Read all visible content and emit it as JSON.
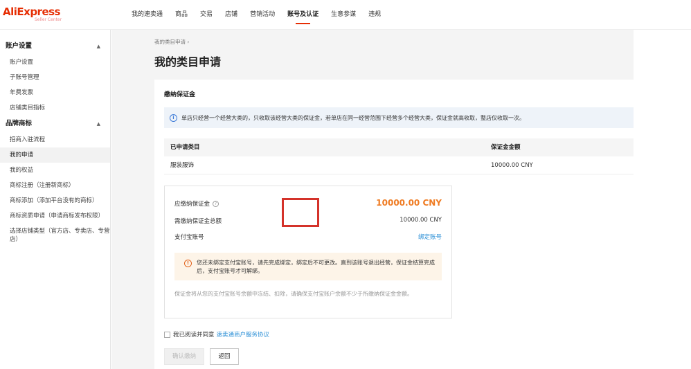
{
  "brand": {
    "name": "AliExpress",
    "sub": "Seller Center",
    "color": "#e62e04"
  },
  "nav": {
    "items": [
      "我的速卖通",
      "商品",
      "交易",
      "店铺",
      "营销活动",
      "账号及认证",
      "生意参谋",
      "违规"
    ],
    "active_index": 5
  },
  "sidebar": {
    "groups": [
      {
        "title": "账户设置",
        "items": [
          "账户设置",
          "子账号管理",
          "年费发票",
          "店铺类目指标"
        ]
      },
      {
        "title": "品牌商标",
        "items": [
          "招商入驻流程",
          "我的申请",
          "我的权益",
          "商标注册（注册新商标）",
          "商标添加（添加平台没有的商标）",
          "商标资质申请（申请商标发布权限）",
          "选择店铺类型（官方店、专卖店、专营店）"
        ]
      }
    ],
    "active_item": "我的申请"
  },
  "breadcrumb": "我的类目申请 ›",
  "page_title": "我的类目申请",
  "section_title": "缴纳保证金",
  "info_text": "单店只经营一个经营大类的，只收取该经营大类的保证金，若单店在同一经营范围下经营多个经营大类，保证金就高收取，整店仅收取一次。",
  "table": {
    "headers": [
      "已申请类目",
      "保证金金额"
    ],
    "rows": [
      [
        "服装服饰",
        "10000.00  CNY"
      ]
    ]
  },
  "deposit": {
    "due_label": "应缴纳保证金",
    "due_amount": "10000.00 CNY",
    "total_label": "需缴纳保证金总额",
    "total_amount": "10000.00 CNY",
    "alipay_label": "支付宝账号",
    "bind_link": "绑定账号",
    "warning": "您还未绑定支付宝账号，请先完成绑定，绑定后不可更改。直到该账号退出经营，保证金结算完成后，支付宝账号才可解绑。",
    "note": "保证金将从您的支付宝账号余额中冻结、扣除，请确保支付宝账户余额不少于所缴纳保证金金额。",
    "amount_color": "#ef7b22",
    "highlight_color": "#d4322a"
  },
  "agreement": {
    "text": "我已阅读并同意",
    "link": "速卖通商户服务协议"
  },
  "buttons": {
    "confirm": "确认缴纳",
    "back": "返回"
  }
}
